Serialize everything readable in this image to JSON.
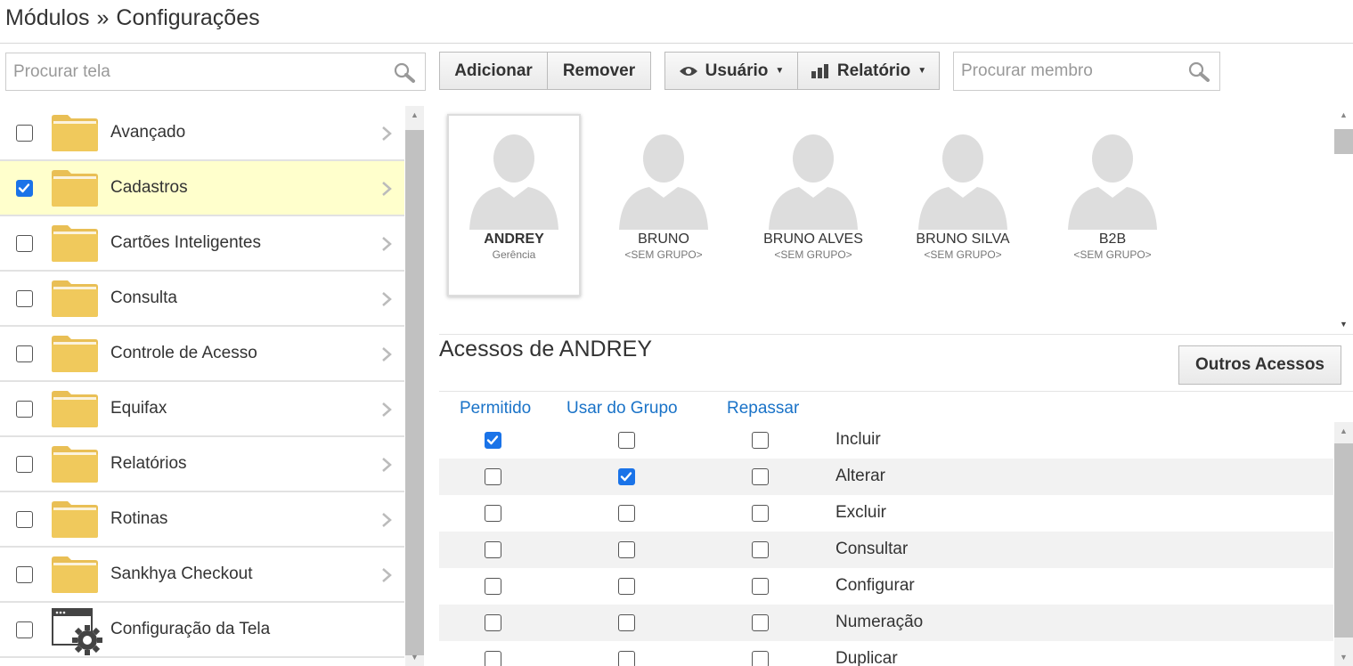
{
  "breadcrumb": {
    "part1": "Módulos",
    "separator": "»",
    "part2": "Configurações"
  },
  "screen_search": {
    "placeholder": "Procurar tela"
  },
  "toolbar": {
    "add_label": "Adicionar",
    "remove_label": "Remover",
    "user_label": "Usuário",
    "report_label": "Relatório",
    "member_search_placeholder": "Procurar membro"
  },
  "screens": [
    {
      "label": "Avançado",
      "checked": false,
      "icon": "folder-icon"
    },
    {
      "label": "Cadastros",
      "checked": true,
      "icon": "folder-icon"
    },
    {
      "label": "Cartões Inteligentes",
      "checked": false,
      "icon": "folder-icon"
    },
    {
      "label": "Consulta",
      "checked": false,
      "icon": "folder-icon"
    },
    {
      "label": "Controle de Acesso",
      "checked": false,
      "icon": "folder-icon"
    },
    {
      "label": "Equifax",
      "checked": false,
      "icon": "folder-icon"
    },
    {
      "label": "Relatórios",
      "checked": false,
      "icon": "folder-icon"
    },
    {
      "label": "Rotinas",
      "checked": false,
      "icon": "folder-icon"
    },
    {
      "label": "Sankhya Checkout",
      "checked": false,
      "icon": "folder-icon"
    },
    {
      "label": "Configuração da Tela",
      "checked": false,
      "icon": "window-gear-icon"
    }
  ],
  "members": [
    {
      "name": "ANDREY",
      "group": "Gerência",
      "selected": true
    },
    {
      "name": "BRUNO",
      "group": "<SEM GRUPO>",
      "selected": false
    },
    {
      "name": "BRUNO ALVES",
      "group": "<SEM GRUPO>",
      "selected": false
    },
    {
      "name": "BRUNO SILVA",
      "group": "<SEM GRUPO>",
      "selected": false
    },
    {
      "name": "B2B",
      "group": "<SEM GRUPO>",
      "selected": false
    }
  ],
  "access": {
    "title": "Acessos de ANDREY",
    "other_access_label": "Outros Acessos",
    "columns": {
      "allowed": "Permitido",
      "use_group": "Usar do Grupo",
      "pass_on": "Repassar"
    },
    "rows": [
      {
        "name": "Incluir",
        "allowed": true,
        "use_group": false,
        "pass_on": false
      },
      {
        "name": "Alterar",
        "allowed": false,
        "use_group": true,
        "pass_on": false
      },
      {
        "name": "Excluir",
        "allowed": false,
        "use_group": false,
        "pass_on": false
      },
      {
        "name": "Consultar",
        "allowed": false,
        "use_group": false,
        "pass_on": false
      },
      {
        "name": "Configurar",
        "allowed": false,
        "use_group": false,
        "pass_on": false
      },
      {
        "name": "Numeração",
        "allowed": false,
        "use_group": false,
        "pass_on": false
      },
      {
        "name": "Duplicar",
        "allowed": false,
        "use_group": false,
        "pass_on": false
      }
    ]
  },
  "colors": {
    "selected_row": "#ffffcc",
    "link_blue": "#1a73c8",
    "check_blue": "#1a73e8",
    "folder_yellow": "#f0c95c"
  }
}
